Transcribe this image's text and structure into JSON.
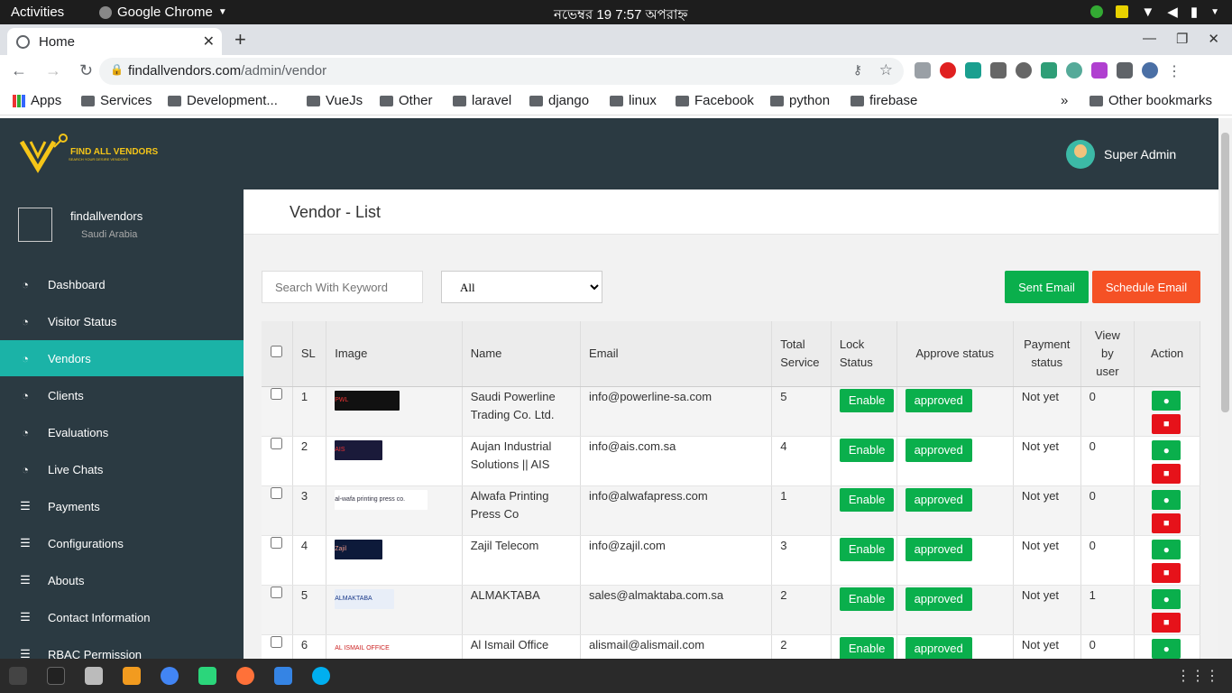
{
  "system_bar": {
    "activities": "Activities",
    "app": "Google Chrome",
    "clock": "নভেম্বর 19   7:57 অপরাহ্ন"
  },
  "browser": {
    "tab_title": "Home",
    "url_host": "findallvendors.com",
    "url_path": "/admin/vendor",
    "bookmarks": [
      "Apps",
      "Services",
      "Development...",
      "VueJs",
      "Other",
      "laravel",
      "django",
      "linux",
      "Facebook",
      "python",
      "firebase"
    ],
    "more_bookmarks": "»",
    "other_bookmarks": "Other bookmarks"
  },
  "app": {
    "logo_text": "FIND ALL VENDORS",
    "logo_tagline": "SEARCH YOUR DESIRE VENDORS",
    "user_name": "Super Admin",
    "profile_name": "findallvendors",
    "profile_location": "Saudi Arabia",
    "accent": "#1bb3a7",
    "menu": [
      {
        "label": "Dashboard",
        "icon": "dashboard-icon"
      },
      {
        "label": "Visitor Status",
        "icon": "dashboard-icon"
      },
      {
        "label": "Vendors",
        "icon": "dashboard-icon",
        "active": true
      },
      {
        "label": "Clients",
        "icon": "dashboard-icon"
      },
      {
        "label": "Evaluations",
        "icon": "dashboard-icon"
      },
      {
        "label": "Live Chats",
        "icon": "dashboard-icon"
      },
      {
        "label": "Payments",
        "icon": "list-icon"
      },
      {
        "label": "Configurations",
        "icon": "list-icon"
      },
      {
        "label": "Abouts",
        "icon": "list-icon"
      },
      {
        "label": "Contact Information",
        "icon": "list-icon"
      },
      {
        "label": "RBAC Permission",
        "icon": "list-icon"
      }
    ]
  },
  "page": {
    "title": "Vendor - List",
    "search_placeholder": "Search With Keyword",
    "filter_value": "All",
    "sent_email": "Sent Email",
    "schedule_email": "Schedule Email"
  },
  "table": {
    "headers": {
      "sl": "SL",
      "image": "Image",
      "name": "Name",
      "email": "Email",
      "total_service": "Total Service",
      "lock_status": "Lock Status",
      "approve_status": "Approve status",
      "payment_status": "Payment status",
      "view_by_user": "View by user",
      "action": "Action"
    },
    "rows": [
      {
        "sl": "1",
        "logo": "PWL",
        "name": "Saudi Powerline Trading Co. Ltd.",
        "email": "info@powerline-sa.com",
        "total": "5",
        "lock": "Enable",
        "approve": "approved",
        "payment": "Not yet",
        "views": "0"
      },
      {
        "sl": "2",
        "logo": "AIS",
        "name": "Aujan Industrial Solutions || AIS",
        "email": "info@ais.com.sa",
        "total": "4",
        "lock": "Enable",
        "approve": "approved",
        "payment": "Not yet",
        "views": "0"
      },
      {
        "sl": "3",
        "logo": "al-wafa printing press co.",
        "name": "Alwafa Printing Press Co",
        "email": "info@alwafapress.com",
        "total": "1",
        "lock": "Enable",
        "approve": "approved",
        "payment": "Not yet",
        "views": "0"
      },
      {
        "sl": "4",
        "logo": "Zajil",
        "name": "Zajil Telecom",
        "email": "info@zajil.com",
        "total": "3",
        "lock": "Enable",
        "approve": "approved",
        "payment": "Not yet",
        "views": "0"
      },
      {
        "sl": "5",
        "logo": "ALMAKTABA",
        "name": "ALMAKTABA",
        "email": "sales@almaktaba.com.sa",
        "total": "2",
        "lock": "Enable",
        "approve": "approved",
        "payment": "Not yet",
        "views": "1"
      },
      {
        "sl": "6",
        "logo": "AL ISMAIL OFFICE SYSTEM",
        "name": "Al Ismail Office Systems",
        "email": "alismail@alismail.com",
        "total": "2",
        "lock": "Enable",
        "approve": "approved",
        "payment": "Not yet",
        "views": "0"
      }
    ]
  }
}
